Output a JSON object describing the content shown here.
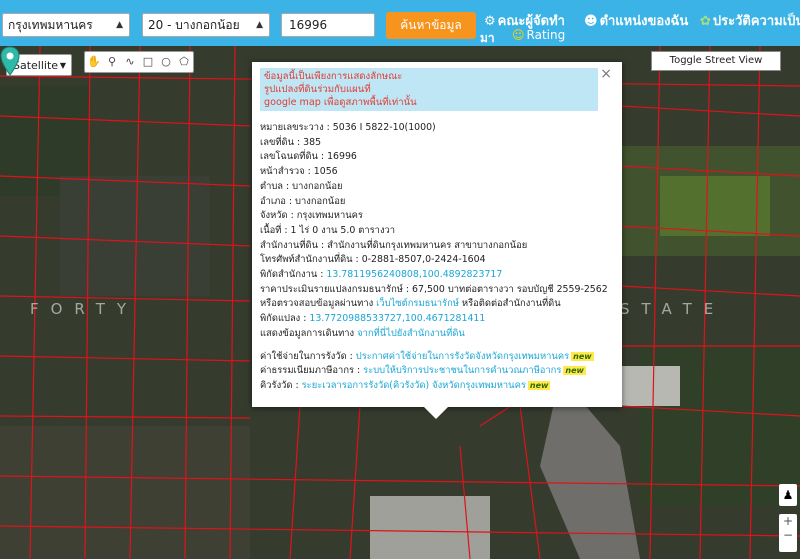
{
  "topbar": {
    "province": "กรุงเทพมหานคร",
    "district": "20 - บางกอกน้อย",
    "deed_number": "16996",
    "search_label": "ค้นหาข้อมูล",
    "nav": {
      "organizers": "คณะผู้จัดทำ",
      "my_location": "ตำแหน่งของฉัน",
      "history": "ประวัติความเป็น",
      "history_cont": "มา",
      "rating": "Rating"
    }
  },
  "map": {
    "map_type": "Satellite",
    "street_view": "Toggle Street View",
    "watermark_left": "FORTY",
    "watermark_right": "STATE",
    "tools": [
      "hand-icon",
      "marker-icon",
      "polyline-icon",
      "rectangle-icon",
      "circle-icon",
      "polygon-icon"
    ]
  },
  "popup": {
    "notice": [
      "ข้อมูลนี้เป็นเพียงการแสดงลักษณะ",
      "รูปแปลงที่ดินร่วมกับแผนที่",
      "google map เพื่อดูสภาพพื้นที่เท่านั้น"
    ],
    "fields": [
      {
        "label": "หมายเลขระวาง : ",
        "value": "5036 I 5822-10(1000)"
      },
      {
        "label": "เลขที่ดิน : ",
        "value": "385"
      },
      {
        "label": "เลขโฉนดที่ดิน : ",
        "value": "16996"
      },
      {
        "label": "หน้าสำรวจ : ",
        "value": "1056"
      },
      {
        "label": "ตำบล : ",
        "value": "บางกอกน้อย"
      },
      {
        "label": "อำเภอ : ",
        "value": "บางกอกน้อย"
      },
      {
        "label": "จังหวัด : ",
        "value": "กรุงเทพมหานคร"
      },
      {
        "label": "เนื้อที่ : ",
        "value": "1 ไร่ 0 งาน 5.0 ตารางวา"
      },
      {
        "label": "สำนักงานที่ดิน : ",
        "value": "สำนักงานที่ดินกรุงเทพมหานคร สาขาบางกอกน้อย"
      },
      {
        "label": "โทรศัพท์สำนักงานที่ดิน : ",
        "value": "0-2881-8507,0-2424-1604"
      }
    ],
    "office_coord_label": "พิกัดสำนักงาน : ",
    "office_coord": "13.7811956240808,100.4892823717",
    "price": "ราคาประเมินรายแปลงกรมธนารักษ์ : 67,500 บาทต่อตารางวา รอบบัญชี 2559-2562",
    "verify_pre": "หรือตรวจสอบข้อมูลผ่านทาง ",
    "verify_link": "เว็บไซต์กรมธนารักษ์",
    "verify_post": " หรือติดต่อสำนักงานที่ดิน",
    "parcel_coord_label": "พิกัดแปลง : ",
    "parcel_coord": "13.7720988533727,100.4671281411",
    "route_pre": "แสดงข้อมูลการเดินทาง ",
    "route_link": "จากที่นี่ไปยังสำนักงานที่ดิน",
    "fees": [
      {
        "label": "ค่าใช้จ่ายในการรังวัด : ",
        "link": "ประกาศค่าใช้จ่ายในการรังวัดจังหวัดกรุงเทพมหานคร"
      },
      {
        "label": "ค่าธรรมเนียมภาษีอากร : ",
        "link": "ระบบให้บริการประชาชนในการคำนวณภาษีอากร"
      },
      {
        "label": "คิวรังวัด : ",
        "link": "ระยะเวลารอการรังวัด(คิวรังวัด) จังหวัดกรุงเทพมหานคร"
      }
    ],
    "new_badge": "new",
    "close": "×"
  },
  "colors": {
    "topbar": "#3bb3e6",
    "search_btn": "#f7941d",
    "parcel_line": "#e0121a",
    "notice_bg": "#bfe6f5"
  }
}
